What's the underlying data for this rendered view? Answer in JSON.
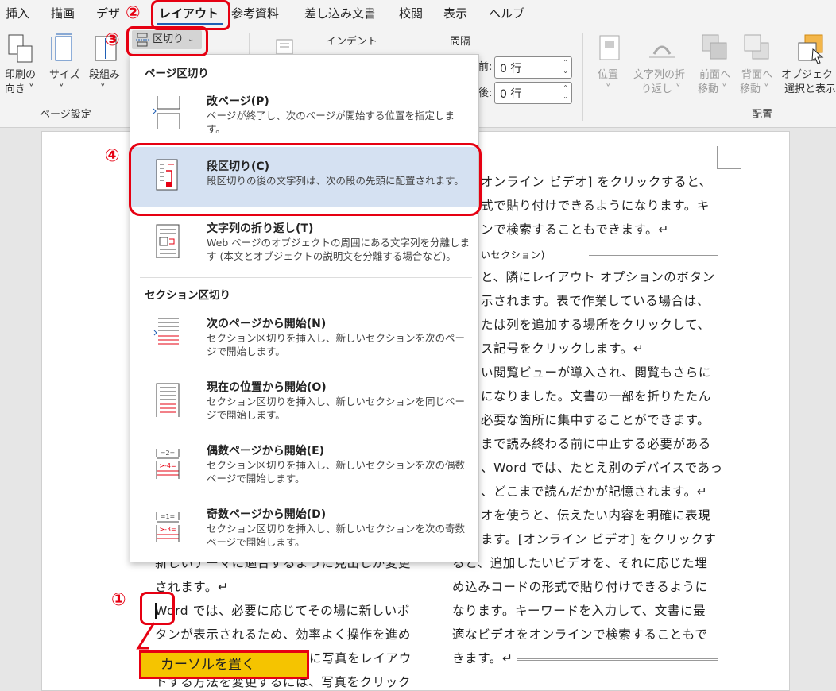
{
  "tabs": [
    "挿入",
    "描画",
    "デザ",
    "レイアウト",
    "参考資料",
    "差し込み文書",
    "校閲",
    "表示",
    "ヘルプ"
  ],
  "ribbon": {
    "orientation_label": [
      "印刷の",
      "向き ˅"
    ],
    "size_label": [
      "サイズ",
      "˅"
    ],
    "columns_label": [
      "段組み",
      "˅"
    ],
    "page_setup_group": "ページ設定",
    "breaks_label": "区切り",
    "indent_header": "インデント",
    "spacing_header": "間隔",
    "before_label": "前:",
    "after_label": "後:",
    "before_value": "0 行",
    "after_value": "0 行",
    "position_label": [
      "位置",
      "˅"
    ],
    "wrap_label": [
      "文字列の折",
      "り返し ˅"
    ],
    "forward_label": [
      "前面へ",
      "移動 ˅"
    ],
    "backward_label": [
      "背面へ",
      "移動 ˅"
    ],
    "selection_label": [
      "オブジェクトの",
      "選択と表示"
    ],
    "arrange_group": "配置"
  },
  "menu": {
    "page_breaks_header": "ページ区切り",
    "section_breaks_header": "セクション区切り",
    "items": [
      {
        "title": "改ページ(P)",
        "desc": "ページが終了し、次のページが開始する位置を指定します。"
      },
      {
        "title": "段区切り(C)",
        "desc": "段区切りの後の文字列は、次の段の先頭に配置されます。"
      },
      {
        "title": "文字列の折り返し(T)",
        "desc": "Web ページのオブジェクトの周囲にある文字列を分離します (本文とオブジェクトの説明文を分離する場合など)。"
      },
      {
        "title": "次のページから開始(N)",
        "desc": "セクション区切りを挿入し、新しいセクションを次のページで開始します。"
      },
      {
        "title": "現在の位置から開始(O)",
        "desc": "セクション区切りを挿入し、新しいセクションを同じページで開始します。"
      },
      {
        "title": "偶数ページから開始(E)",
        "desc": "セクション区切りを挿入し、新しいセクションを次の偶数ページで開始します。"
      },
      {
        "title": "奇数ページから開始(D)",
        "desc": "セクション区切りを挿入し、新しいセクションを次の奇数ページで開始します。"
      }
    ]
  },
  "doc": {
    "right_col": [
      "オンライン ビデオ] をクリックすると、",
      "式で貼り付けできるようになります。キ",
      "ンで検索することもできます。↵",
      "いセクション)",
      "と、隣にレイアウト オプションのボタン",
      "示されます。表で作業している場合は、",
      "たは列を追加する場所をクリックして、",
      "ス記号をクリックします。↵",
      "い閲覧ビューが導入され、閲覧もさらに",
      "になりました。文書の一部を折りたたん",
      "必要な箇所に集中することができます。",
      "まで読み終わる前に中止する必要がある",
      "、Word では、たとえ別のデバイスであっ",
      "、どこまで読んだかが記憶されます。↵",
      "オを使うと、伝えたい内容を明確に表現",
      "ます。[オンライン ビデオ] をクリックす",
      "ると、追加したいビデオを、それに応じた埋",
      "め込みコードの形式で貼り付けできるように",
      "なります。キーワードを入力して、文書に最",
      "適なビデオをオンラインで検索することもで",
      "きます。↵"
    ],
    "left_col": [
      "新しいテーマに適合するように見出しが変更",
      "されます。↵",
      "Word では、必要に応じてその場に新しいボ",
      "タンが表示されるため、効率よく操作を進め",
      "に写真をレイアウ",
      "トする方法を変更するには、写真をクリック"
    ]
  },
  "annotations": {
    "step1": "①",
    "step2": "②",
    "step3": "③",
    "step4": "④",
    "callout": "カーソルを置く"
  },
  "colors": {
    "accent_red": "#e60012",
    "callout_yellow": "#f5c400",
    "highlight_blue": "#d5e1f2",
    "tab_underline": "#1f5fb5"
  }
}
